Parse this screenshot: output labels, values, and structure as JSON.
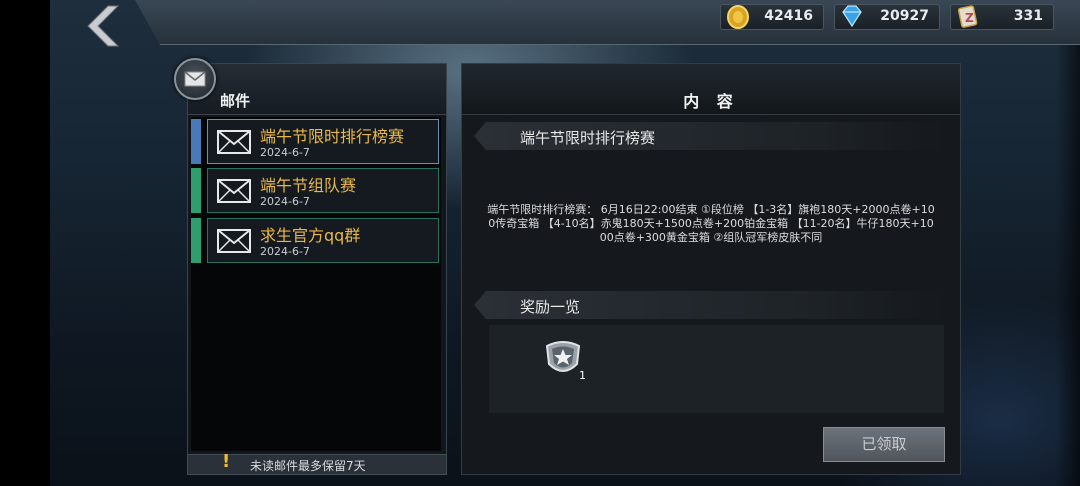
{
  "resources": [
    {
      "icon": "gold-coin-icon",
      "value": "42416"
    },
    {
      "icon": "diamond-icon",
      "value": "20927"
    },
    {
      "icon": "voucher-icon",
      "value": "331"
    }
  ],
  "mailbox": {
    "title": "邮件",
    "items": [
      {
        "subject": "端午节限时排行榜赛",
        "date": "2024-6-7",
        "stripe": "#4a79b8"
      },
      {
        "subject": "端午节组队赛",
        "date": "2024-6-7",
        "stripe": "#2e9e6e"
      },
      {
        "subject": "求生官方qq群",
        "date": "2024-6-7",
        "stripe": "#2e9e6e"
      }
    ],
    "notice": "未读邮件最多保留7天"
  },
  "content": {
    "header": "内 容",
    "subject": "端午节限时排行榜赛",
    "body": "端午节限时排行榜赛：  6月16日22:00结束 ①段位榜 【1-3名】旗袍180天+2000点卷+100传奇宝箱 【4-10名】赤鬼180天+1500点卷+200铂金宝箱 【11-20名】牛仔180天+1000点卷+300黄金宝箱 ②组队冠军榜皮肤不同",
    "rewards_label": "奖励一览",
    "rewards": [
      {
        "icon": "rank-badge-icon",
        "count": "1"
      }
    ],
    "claim_label": "已领取"
  }
}
